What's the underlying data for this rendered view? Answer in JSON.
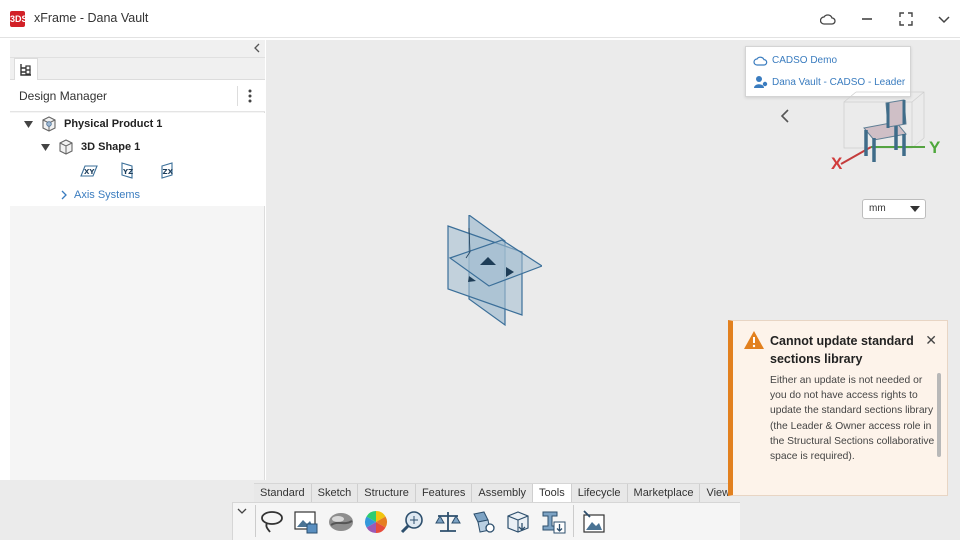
{
  "app": {
    "logo": "3DS",
    "title": "xFrame - Dana Vault"
  },
  "window_controls": [
    "cloud-icon",
    "minimize-icon",
    "fullscreen-icon",
    "chevron-down-icon"
  ],
  "design_manager": {
    "title": "Design Manager",
    "tree": {
      "root": "Physical Product 1",
      "child": "3D Shape 1",
      "planes": [
        "XY",
        "YZ",
        "ZX"
      ],
      "axis_systems": "Axis Systems"
    }
  },
  "account_popup": {
    "platform": "CADSO Demo",
    "role": "Dana Vault - CADSO - Leader"
  },
  "compass": {
    "x_label": "X",
    "y_label": "Y"
  },
  "units": {
    "selected": "mm"
  },
  "action_bar": {
    "tabs": [
      "Standard",
      "Sketch",
      "Structure",
      "Features",
      "Assembly",
      "Tools",
      "Lifecycle",
      "Marketplace",
      "View"
    ],
    "active_tab": "Tools",
    "tools": [
      "lasso-icon",
      "capture-image-icon",
      "render-material-icon",
      "color-wheel-icon",
      "inspect-zoom-icon",
      "balance-scale-icon",
      "assembly-icon",
      "package-icon",
      "section-import-icon",
      "image-export-icon"
    ]
  },
  "notification": {
    "title": "Cannot update standard sections library",
    "body": "Either an update is not needed or you do not have access rights to update the standard sections library (the Leader & Owner access role in the Structural Sections collaborative space is required).",
    "severity_color": "#e2801e"
  }
}
